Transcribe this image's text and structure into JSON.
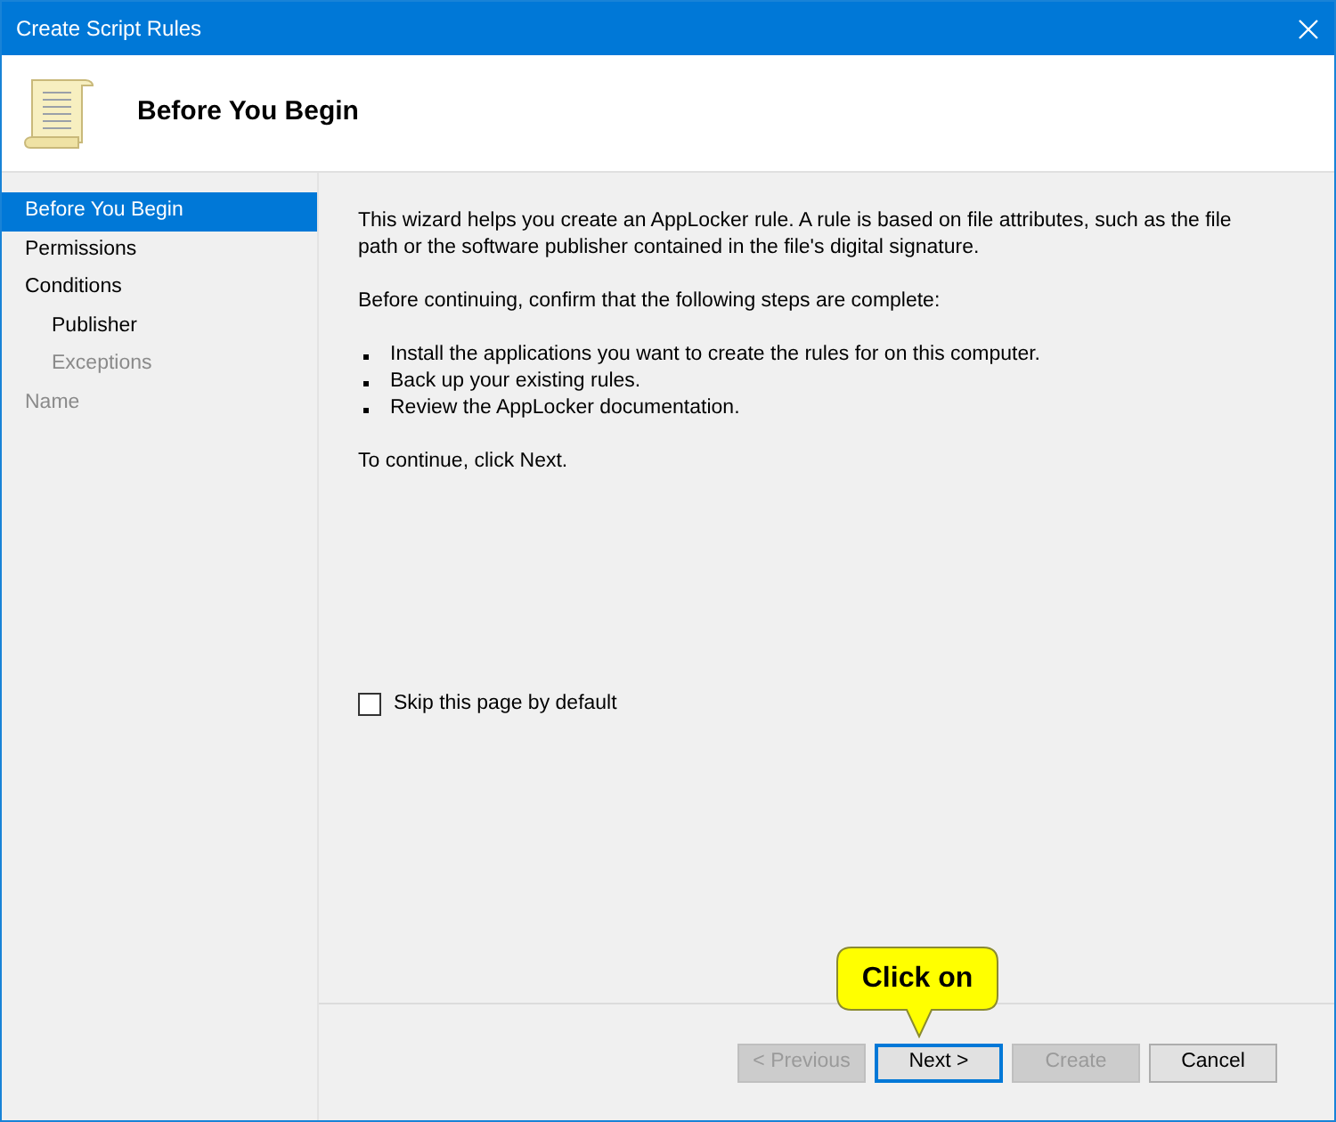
{
  "window": {
    "title": "Create Script Rules"
  },
  "header": {
    "title": "Before You Begin"
  },
  "steps": [
    {
      "label": "Before You Begin",
      "selected": true,
      "disabled": false
    },
    {
      "label": "Permissions",
      "selected": false,
      "disabled": false
    },
    {
      "label": "Conditions",
      "selected": false,
      "disabled": false,
      "children": [
        {
          "label": "Publisher",
          "selected": false,
          "disabled": false
        },
        {
          "label": "Exceptions",
          "selected": false,
          "disabled": true
        }
      ]
    },
    {
      "label": "Name",
      "selected": false,
      "disabled": true
    }
  ],
  "content": {
    "intro": "This wizard helps you create an AppLocker rule. A rule is based on file attributes, such as the file path or the software publisher contained in the file's digital signature.",
    "before": "Before continuing, confirm that the following steps are complete:",
    "bullets": [
      "Install the applications you want to create the rules for on this computer.",
      "Back up your existing rules.",
      "Review the AppLocker documentation."
    ],
    "outro": "To continue, click Next."
  },
  "skip_checkbox": {
    "label": "Skip this page by default",
    "checked": false
  },
  "callout": {
    "text": "Click on"
  },
  "buttons": [
    {
      "label": "< Previous",
      "disabled": true,
      "focused": false
    },
    {
      "label": "Next >",
      "disabled": false,
      "focused": true
    },
    {
      "label": "Create",
      "disabled": true,
      "focused": false
    },
    {
      "label": "Cancel",
      "disabled": false,
      "focused": false
    }
  ]
}
